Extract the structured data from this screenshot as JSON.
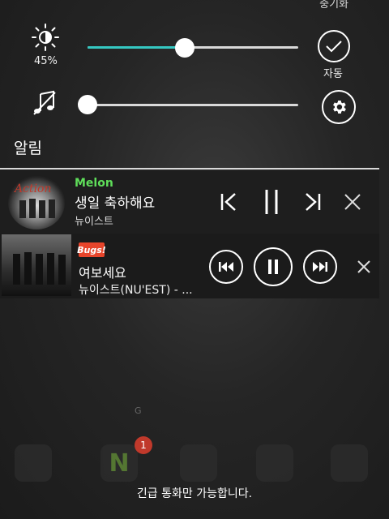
{
  "quick_panel": {
    "top_partial_label": "중기화",
    "brightness_percent_label": "45%",
    "brightness_level": 0.45,
    "volume_level": 0.0,
    "auto_label": "자동"
  },
  "notifications": {
    "section_title": "알림",
    "items": [
      {
        "app": "Melon",
        "title": "생일 축하해요",
        "artist": "뉴이스트"
      },
      {
        "app": "Bugs!",
        "title": "여보세요",
        "artist": "뉴이스트(NU'EST) - ..."
      }
    ]
  },
  "home": {
    "badge_count": "1",
    "dock_letter": "N",
    "watermark_letter": "G"
  },
  "status": {
    "emergency_text": "긴급 통화만 가능합니다."
  },
  "colors": {
    "accent": "#35c8c2",
    "melon": "#5fde5a",
    "bugs": "#e8452b"
  }
}
